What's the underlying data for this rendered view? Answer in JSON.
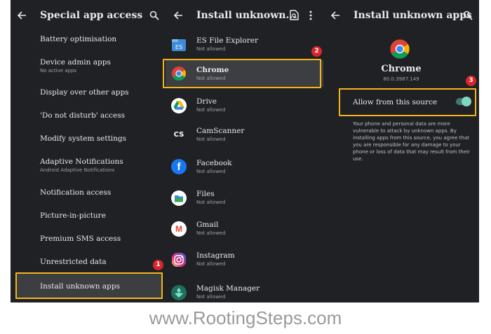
{
  "colors": {
    "panel_bg": "#202124",
    "highlight": "#f3b51a",
    "badge": "#d9262c",
    "accent": "#4fb3a3"
  },
  "panel1": {
    "title": "Special app access",
    "items": [
      {
        "label": "Battery optimisation",
        "sub": ""
      },
      {
        "label": "Device admin apps",
        "sub": "No active apps"
      },
      {
        "label": "Display over other apps",
        "sub": ""
      },
      {
        "label": "'Do not disturb' access",
        "sub": ""
      },
      {
        "label": "Modify system settings",
        "sub": ""
      },
      {
        "label": "Adaptive Notifications",
        "sub": "Android Adaptive Notifications"
      },
      {
        "label": "Notification access",
        "sub": ""
      },
      {
        "label": "Picture-in-picture",
        "sub": ""
      },
      {
        "label": "Premium SMS access",
        "sub": ""
      },
      {
        "label": "Unrestricted data",
        "sub": ""
      },
      {
        "label": "Install unknown apps",
        "sub": ""
      }
    ],
    "badge": "1"
  },
  "panel2": {
    "title": "Install unknown...",
    "apps": [
      {
        "name": "ES File Explorer",
        "status": "Not allowed",
        "icon": "es-file-explorer-icon"
      },
      {
        "name": "Chrome",
        "status": "Not allowed",
        "icon": "chrome-icon"
      },
      {
        "name": "Drive",
        "status": "Not allowed",
        "icon": "drive-icon"
      },
      {
        "name": "CamScanner",
        "status": "Not allowed",
        "icon": "camscanner-icon"
      },
      {
        "name": "Facebook",
        "status": "Not allowed",
        "icon": "facebook-icon"
      },
      {
        "name": "Files",
        "status": "Not allowed",
        "icon": "files-icon"
      },
      {
        "name": "Gmail",
        "status": "Not allowed",
        "icon": "gmail-icon"
      },
      {
        "name": "Instagram",
        "status": "Not allowed",
        "icon": "instagram-icon"
      },
      {
        "name": "Magisk Manager",
        "status": "Not allowed",
        "icon": "magisk-icon"
      }
    ],
    "camscanner_glyph": "CS",
    "facebook_glyph": "f",
    "gmail_glyph": "M",
    "badge": "2"
  },
  "panel3": {
    "title": "Install unknown apps",
    "app_name": "Chrome",
    "version": "80.0.3987.149",
    "toggle_label": "Allow from this source",
    "toggle_on": true,
    "warning": "Your phone and personal data are more vulnerable to attack by unknown apps. By installing apps from this source, you agree that you are responsible for any damage to your phone or loss of data that may result from their use.",
    "badge": "3"
  },
  "watermark": "www.RootingSteps.com"
}
